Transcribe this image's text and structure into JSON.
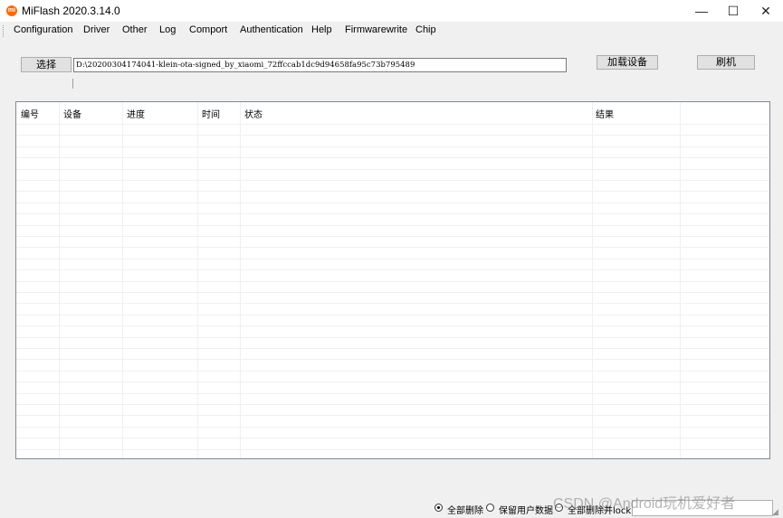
{
  "window": {
    "title": "MiFlash 2020.3.14.0",
    "app_icon": "mi",
    "controls": {
      "minimize": "—",
      "maximize": "☐",
      "close": "✕"
    }
  },
  "menu": {
    "items": [
      "Configuration",
      "Driver",
      "Other",
      "Log",
      "Comport",
      "Authentication",
      "Help",
      "Firmwarewrite",
      "Chip"
    ]
  },
  "toolbar": {
    "select_label": "选择",
    "path_value": "D:\\20200304174041-klein-ota-signed_by_xiaomi_72ffccab1dc9d94658fa95c73b795489",
    "load_device_label": "加载设备",
    "flash_label": "刷机"
  },
  "table": {
    "columns": [
      "编号",
      "设备",
      "进度",
      "时间",
      "状态",
      "结果",
      ""
    ],
    "rows": []
  },
  "options": {
    "radios": [
      {
        "label": "全部删除",
        "selected": true
      },
      {
        "label": "保留用户数据",
        "selected": false
      },
      {
        "label": "全部删除并lock",
        "selected": false
      }
    ]
  },
  "watermark": "CSDN @Android玩机爱好者"
}
